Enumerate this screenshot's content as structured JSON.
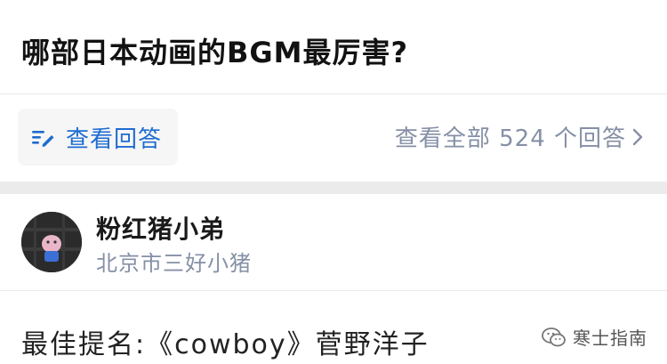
{
  "question": {
    "title": "哪部日本动画的BGM最厉害?"
  },
  "actions": {
    "view_answer_label": "查看回答",
    "all_answers_label": "查看全部 524 个回答"
  },
  "answer": {
    "author_name": "粉红猪小弟",
    "author_headline": "北京市三好小猪",
    "content": "最佳提名:《cowboy》菅野洋子"
  },
  "watermark": {
    "text": "寒士指南"
  },
  "colors": {
    "accent": "#1e6cd0",
    "muted": "#8590a6",
    "divider": "#ebebeb"
  }
}
